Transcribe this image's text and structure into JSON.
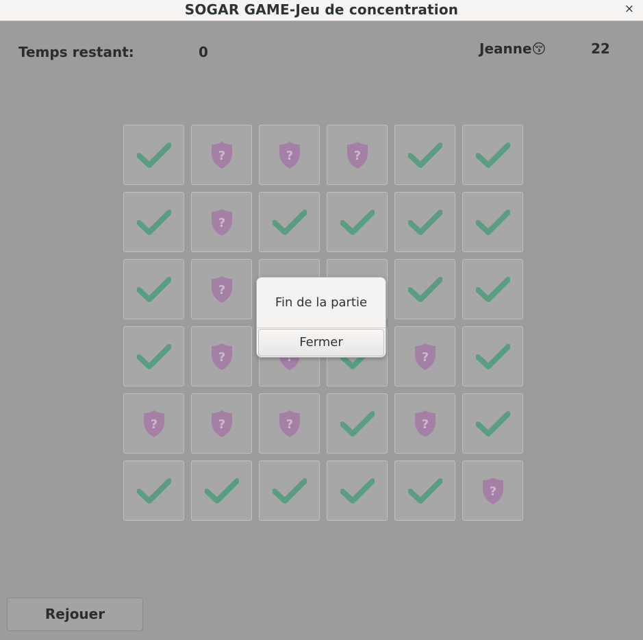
{
  "window": {
    "title": "SOGAR GAME-Jeu de concentration",
    "close_glyph": "×"
  },
  "status": {
    "time_label": "Temps restant:",
    "time_value": "0",
    "player_name": "Jeanne😚",
    "score": "22"
  },
  "icons": {
    "found": "check-icon",
    "hidden": "shield-question-icon"
  },
  "colors": {
    "check": "#5a9e82",
    "shield": "#a47fa6"
  },
  "grid": [
    [
      "check",
      "shield",
      "shield",
      "shield",
      "check",
      "check"
    ],
    [
      "check",
      "shield",
      "check",
      "check",
      "check",
      "check"
    ],
    [
      "check",
      "shield",
      "check",
      "check",
      "check",
      "check"
    ],
    [
      "check",
      "shield",
      "shield",
      "check",
      "shield",
      "check"
    ],
    [
      "shield",
      "shield",
      "shield",
      "check",
      "shield",
      "check"
    ],
    [
      "check",
      "check",
      "check",
      "check",
      "check",
      "shield"
    ]
  ],
  "replay_label": "Rejouer",
  "dialog": {
    "message": "Fin de la partie",
    "button_label": "Fermer"
  }
}
